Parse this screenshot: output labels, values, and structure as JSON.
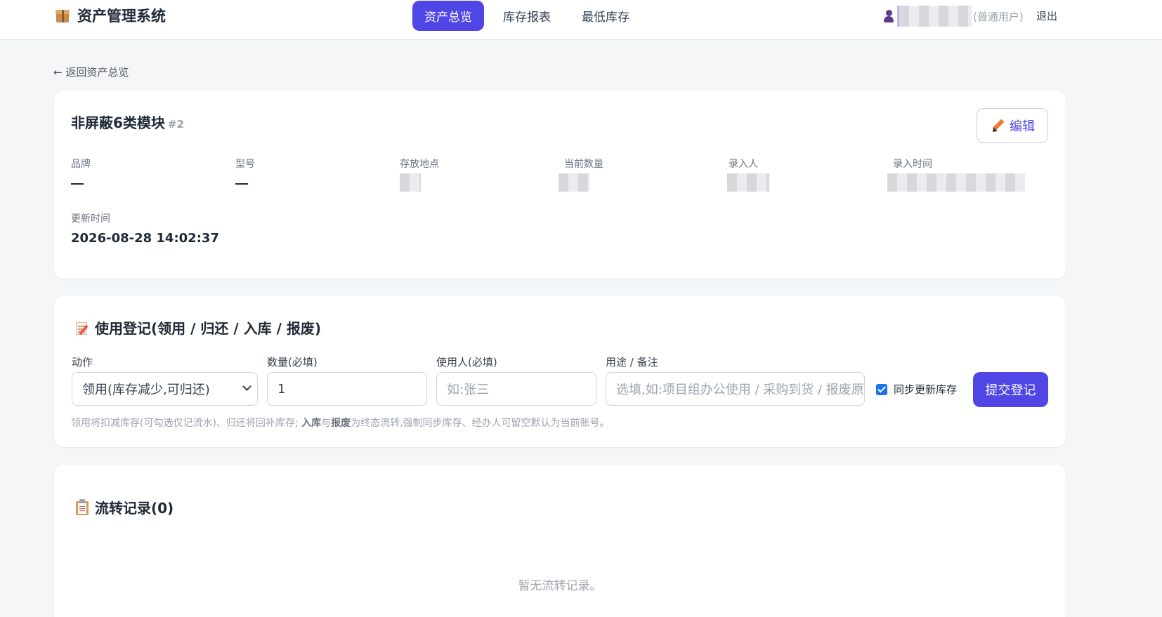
{
  "app": {
    "title": "资产管理系统"
  },
  "nav": {
    "items": [
      {
        "label": "资产总览",
        "active": true
      },
      {
        "label": "库存报表",
        "active": false
      },
      {
        "label": "最低库存",
        "active": false
      }
    ]
  },
  "user": {
    "role": "(普通用户)",
    "logout_label": "退出"
  },
  "back_link": "← 返回资产总览",
  "asset": {
    "name": "非屏蔽6类模块",
    "id": "#2",
    "edit_label": "编辑",
    "fields": {
      "brand": {
        "label": "品牌",
        "value": "—"
      },
      "model": {
        "label": "型号",
        "value": "—"
      },
      "location": {
        "label": "存放地点"
      },
      "quantity": {
        "label": "当前数量"
      },
      "recorder": {
        "label": "录入人"
      },
      "recorded_at": {
        "label": "录入时间"
      },
      "updated_at": {
        "label": "更新时间",
        "value": "2026-08-28 14:02:37"
      }
    }
  },
  "usage_form": {
    "title": "使用登记(领用 / 归还 / 入库 / 报废)",
    "action": {
      "label": "动作",
      "value": "领用(库存减少,可归还)"
    },
    "quantity": {
      "label": "数量(必填)",
      "value": "1"
    },
    "user": {
      "label": "使用人(必填)",
      "placeholder": "如:张三"
    },
    "purpose": {
      "label": "用途 / 备注",
      "placeholder": "选填,如:项目组办公使用 / 采购到货 / 报废原因"
    },
    "sync_checkbox": {
      "label": "同步更新库存",
      "checked": true
    },
    "submit_label": "提交登记",
    "hint": {
      "part1": "领用将扣减库存(可勾选仅记流水)、归还将回补库存; ",
      "bold1": "入库",
      "part2": "与",
      "bold2": "报废",
      "part3": "为终态流转,强制同步库存、经办人可留空默认为当前账号。"
    }
  },
  "transfer_records": {
    "title": "流转记录(0)",
    "empty_text": "暂无流转记录。"
  },
  "colors": {
    "accent": "#4f46e5",
    "background": "#f5f6f8",
    "card": "#ffffff"
  }
}
